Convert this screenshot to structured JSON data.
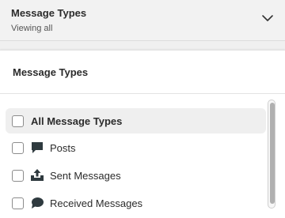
{
  "header": {
    "title": "Message Types",
    "subtitle": "Viewing all",
    "toggle_icon": "chevron-down-icon"
  },
  "panel": {
    "title": "Message Types",
    "options": [
      {
        "label": "All Message Types",
        "icon": null,
        "checked": false,
        "highlighted": true
      },
      {
        "label": "Posts",
        "icon": "post-icon",
        "checked": false,
        "highlighted": false
      },
      {
        "label": "Sent Messages",
        "icon": "sent-icon",
        "checked": false,
        "highlighted": false
      },
      {
        "label": "Received Messages",
        "icon": "received-icon",
        "checked": false,
        "highlighted": false
      }
    ]
  },
  "colors": {
    "icon": "#2f3a3f",
    "highlight": "#efefef"
  }
}
